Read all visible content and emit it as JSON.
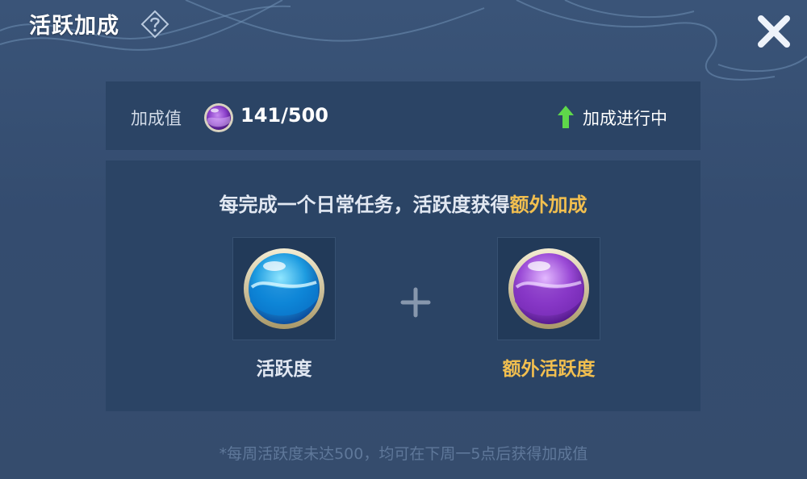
{
  "dialog": {
    "title": "活跃加成"
  },
  "bonus_bar": {
    "label": "加成值",
    "value": "141/500",
    "status": "加成进行中"
  },
  "info": {
    "headline_prefix": "每完成一个日常任务，活跃度获得",
    "headline_highlight": "额外加成",
    "left_label": "活跃度",
    "right_label": "额外活跃度"
  },
  "footnote": "*每周活跃度未达500，均可在下周一5点后获得加成值",
  "colors": {
    "highlight": "#f2bf4f",
    "panel": "#2b4465",
    "background": "#354c6d"
  },
  "icons": {
    "help": "question-diamond-icon",
    "close": "close-x-icon",
    "bonus_orb": "purple-orb-icon",
    "status_arrow": "green-up-arrow-icon",
    "blue_orb": "blue-orb-icon",
    "purple_orb": "purple-orb-icon",
    "plus": "plus-icon"
  }
}
